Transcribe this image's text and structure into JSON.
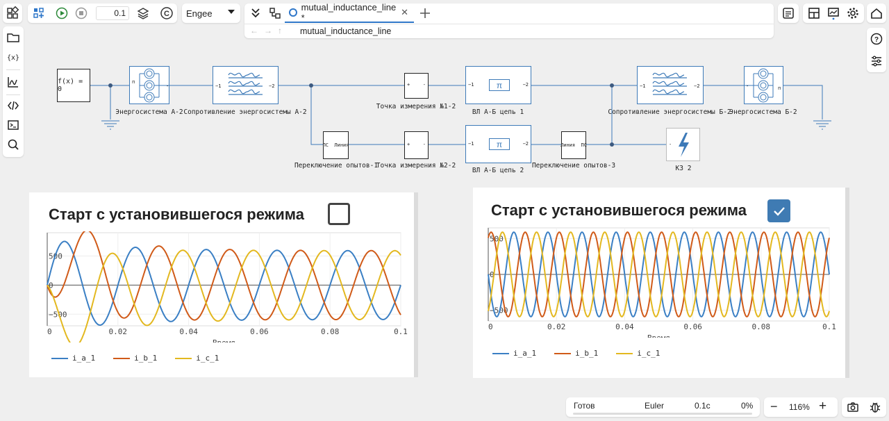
{
  "toolbar": {
    "sim_time": "0.1",
    "solver_select": "Engee",
    "tab_label": "mutual_inductance_line *",
    "path_label": "mutual_inductance_line"
  },
  "sidebar": {
    "items": [
      "folder-icon",
      "variables-icon",
      "plot-icon",
      "code-icon",
      "terminal-icon",
      "search-icon"
    ]
  },
  "diagram": {
    "blocks": {
      "fx_label": "f(x) = 0",
      "src1_label": "Энергосистема А-2",
      "z1_label": "Сопротивление энергосистемы А-2",
      "meas1_label": "Точка измерения №1-2",
      "line1_label": "ВЛ А-Б цепь 1",
      "z2_label": "Сопротивление энергосистемы Б-2",
      "src2_label": "Энергосистема Б-2",
      "sw1_label": "Переключение опытов-1",
      "meas2_label": "Точка измерения №2-2",
      "line2_label": "ВЛ А-Б цепь 2",
      "sw3_label": "Переключение опытов-3",
      "kz_label": "КЗ 2",
      "sw1_text": "ПС  Линия",
      "sw3_text": "Линия  ПС",
      "port_m1": "−1",
      "port_m2": "−2",
      "port_n": "п",
      "pi": "π"
    }
  },
  "plots": [
    {
      "title": "Старт с установившегося режима",
      "checked": false,
      "xlabel": "Время",
      "yticks": [
        "500",
        "0",
        "−500"
      ],
      "xticks": [
        "0",
        "0.02",
        "0.04",
        "0.06",
        "0.08",
        "0.1"
      ],
      "legend": [
        "i_a_1",
        "i_b_1",
        "i_c_1"
      ]
    },
    {
      "title": "Старт с установившегося режима",
      "checked": true,
      "xlabel": "Время",
      "yticks": [
        "500",
        "0",
        "−500"
      ],
      "xticks": [
        "0",
        "0.02",
        "0.04",
        "0.06",
        "0.08",
        "0.1"
      ],
      "legend": [
        "i_a_1",
        "i_b_1",
        "i_c_1"
      ]
    }
  ],
  "chart_data": [
    {
      "type": "line",
      "title": "Старт с установившегося режима",
      "xlabel": "Время",
      "ylabel": "",
      "xlim": [
        0,
        0.1
      ],
      "ylim": [
        -700,
        900
      ],
      "legend_position": "bottom",
      "series": [
        {
          "name": "i_a_1",
          "color": "#3a7fc4",
          "amplitude": 590,
          "frequency_hz": 50,
          "phase_deg": 0,
          "transient": "start at 0 with decaying offset"
        },
        {
          "name": "i_b_1",
          "color": "#d05a18",
          "amplitude": 590,
          "frequency_hz": 50,
          "phase_deg": -120,
          "transient": "start at 0 with decaying offset"
        },
        {
          "name": "i_c_1",
          "color": "#e3b81f",
          "amplitude": 590,
          "frequency_hz": 50,
          "phase_deg": 120,
          "transient": "start at 0 with decaying offset"
        }
      ]
    },
    {
      "type": "line",
      "title": "Старт с установившегося режима",
      "xlabel": "Время",
      "ylabel": "",
      "xlim": [
        0,
        0.1
      ],
      "ylim": [
        -650,
        650
      ],
      "legend_position": "bottom",
      "series": [
        {
          "name": "i_a_1",
          "color": "#3a7fc4",
          "amplitude": 590,
          "frequency_hz": 100,
          "phase_deg": 180
        },
        {
          "name": "i_b_1",
          "color": "#d05a18",
          "amplitude": 590,
          "frequency_hz": 100,
          "phase_deg": 60
        },
        {
          "name": "i_c_1",
          "color": "#e3b81f",
          "amplitude": 590,
          "frequency_hz": 100,
          "phase_deg": -60
        }
      ]
    }
  ],
  "statusbar": {
    "status": "Готов",
    "solver": "Euler",
    "time": "0.1с",
    "progress": "0%",
    "zoom": "116%"
  }
}
